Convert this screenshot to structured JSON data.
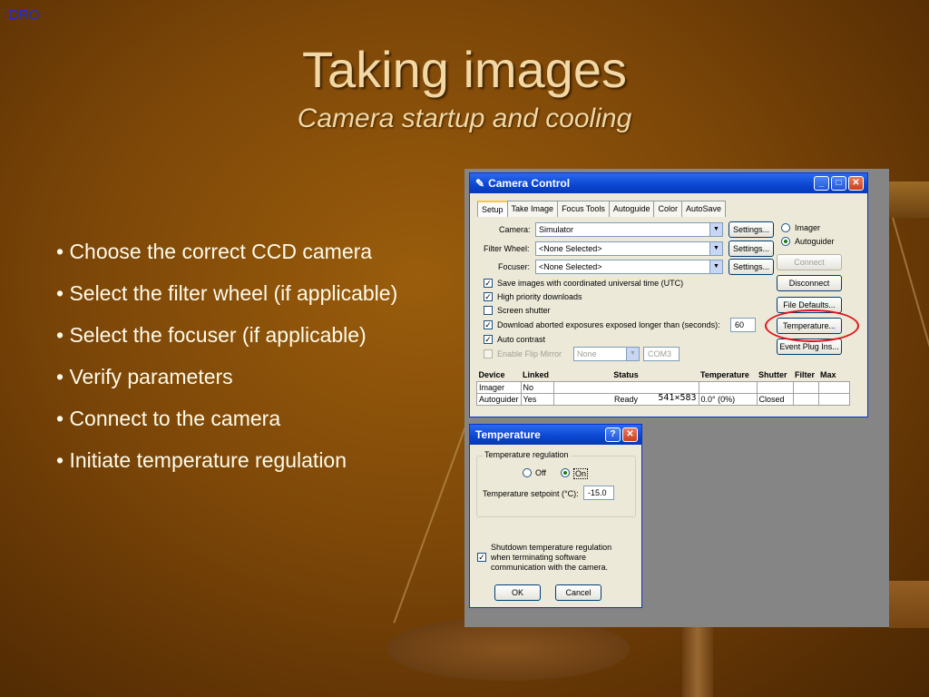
{
  "corner_label": "DRO",
  "slide": {
    "title": "Taking images",
    "subtitle": "Camera startup and cooling",
    "bullets": [
      "• Choose the correct CCD camera",
      "• Select the filter wheel (if applicable)",
      "• Select the focuser (if applicable)",
      "• Verify parameters",
      "• Connect to the camera",
      "• Initiate temperature regulation"
    ]
  },
  "camera_control": {
    "title": "Camera Control",
    "tabs": [
      "Setup",
      "Take Image",
      "Focus Tools",
      "Autoguide",
      "Color",
      "AutoSave"
    ],
    "active_tab": "Setup",
    "camera_label": "Camera:",
    "camera_value": "Simulator",
    "filter_wheel_label": "Filter Wheel:",
    "filter_wheel_value": "<None Selected>",
    "focuser_label": "Focuser:",
    "focuser_value": "<None Selected>",
    "settings_label": "Settings...",
    "radio_imager": "Imager",
    "radio_autoguider": "Autoguider",
    "connect_label": "Connect",
    "disconnect_label": "Disconnect",
    "file_defaults_label": "File Defaults...",
    "temperature_label": "Temperature...",
    "event_plugins_label": "Event Plug Ins...",
    "options": [
      {
        "label": "Save images with coordinated universal time (UTC)",
        "checked": true
      },
      {
        "label": "High priority downloads",
        "checked": true
      },
      {
        "label": "Screen shutter",
        "checked": false
      },
      {
        "label": "Download aborted exposures exposed longer than (seconds):",
        "checked": true
      },
      {
        "label": "Auto contrast",
        "checked": true
      },
      {
        "label": "Enable Flip Mirror",
        "checked": false
      }
    ],
    "abort_seconds": "60",
    "flip_none": "None",
    "flip_port": "COM3",
    "grid_headers": [
      "Device",
      "Linked",
      "Status",
      "Temperature",
      "Shutter",
      "Filter",
      "Max"
    ],
    "grid_rows": [
      [
        "Imager",
        "No",
        "",
        "",
        "",
        "",
        ""
      ],
      [
        "Autoguider",
        "Yes",
        "Ready",
        "0.0° (0%)",
        "Closed",
        "",
        ""
      ]
    ],
    "dimensions_overlay": "541×583"
  },
  "temperature_dialog": {
    "title": "Temperature",
    "group_label": "Temperature regulation",
    "off_label": "Off",
    "on_label": "On",
    "setpoint_label": "Temperature setpoint (°C):",
    "setpoint_value": "-15.0",
    "shutdown_line1": "Shutdown temperature regulation",
    "shutdown_line2": "when terminating software",
    "shutdown_line3": "communication with the camera.",
    "ok_label": "OK",
    "cancel_label": "Cancel"
  },
  "colors": {
    "title_text": "#f1d8a4",
    "bullet_text": "#fffbe9",
    "corner_label": "#1a2fd8",
    "highlight_ring": "#e0151c"
  }
}
